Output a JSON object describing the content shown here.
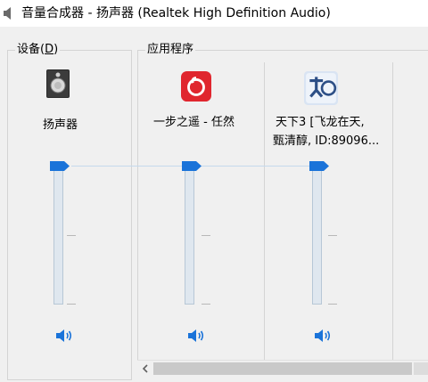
{
  "window": {
    "title": "音量合成器 - 扬声器 (Realtek High Definition Audio)",
    "title_icon": "speaker-icon"
  },
  "device_section": {
    "label": "设备(",
    "label_key": "D",
    "label_end": ")",
    "device": {
      "name": "扬声器",
      "icon": "speaker-device-icon"
    }
  },
  "apps_section": {
    "label": "应用程序",
    "apps": [
      {
        "name": "一步之遥 - 任然",
        "icon": "netease-music-icon"
      },
      {
        "name_line1": "天下3 [飞龙在天,",
        "name_line2": "甄清醇, ID:89096...",
        "icon": "tianxia3-game-icon"
      }
    ]
  },
  "volumes": {
    "device": 100,
    "app1": 100,
    "app2": 100
  },
  "colors": {
    "accent": "#1a73d9",
    "track": "#dfe7ef",
    "music_red": "#e0262e"
  }
}
